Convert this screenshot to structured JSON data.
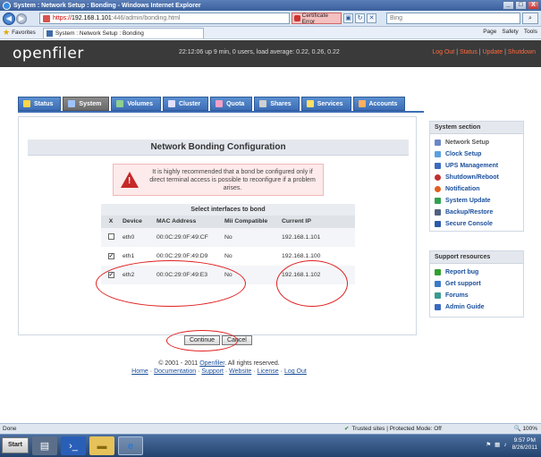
{
  "window": {
    "title": "System : Network Setup : Bonding - Windows Internet Explorer",
    "controls": [
      "_",
      "□",
      "X"
    ]
  },
  "address": {
    "scheme": "https://",
    "host": "192.168.1.101",
    "path": ":446/admin/bonding.html",
    "cert_error": "Certificate Error",
    "search_placeholder": "Bing"
  },
  "favbar": {
    "favorites": "Favorites",
    "tab_title": "System : Network Setup : Bonding",
    "tools": [
      "Page",
      "Safety",
      "Tools"
    ]
  },
  "header": {
    "logo": "openfiler",
    "uptime": "22:12:06 up 9 min, 0 users, load average: 0.22, 0.26, 0.22",
    "links": [
      "Log Out",
      "Status",
      "Update",
      "Shutdown"
    ]
  },
  "tabs": [
    {
      "label": "Status"
    },
    {
      "label": "System"
    },
    {
      "label": "Volumes"
    },
    {
      "label": "Cluster"
    },
    {
      "label": "Quota"
    },
    {
      "label": "Shares"
    },
    {
      "label": "Services"
    },
    {
      "label": "Accounts"
    }
  ],
  "main": {
    "title": "Network Bonding Configuration",
    "warning": "It is highly recommended that a bond be configured only if direct terminal access is possible to reconfigure if a problem arises.",
    "table_caption": "Select interfaces to bond",
    "columns": [
      "X",
      "Device",
      "MAC Address",
      "Mii Compatible",
      "Current IP"
    ],
    "rows": [
      {
        "device": "eth0",
        "mac": "00:0C:29:0F:49:CF",
        "mii": "No",
        "ip": "192.168.1.101"
      },
      {
        "device": "eth1",
        "mac": "00:0C:29:0F:49:D9",
        "mii": "No",
        "ip": "192.168.1.100"
      },
      {
        "device": "eth2",
        "mac": "00:0C:29:0F:49:E3",
        "mii": "No",
        "ip": "192.168.1.102"
      }
    ],
    "continue_label": "Continue",
    "cancel_label": "Cancel"
  },
  "system_section": {
    "title": "System section",
    "items": [
      "Network Setup",
      "Clock Setup",
      "UPS Management",
      "Shutdown/Reboot",
      "Notification",
      "System Update",
      "Backup/Restore",
      "Secure Console"
    ]
  },
  "support": {
    "title": "Support resources",
    "items": [
      "Report bug",
      "Get support",
      "Forums",
      "Admin Guide"
    ]
  },
  "footer": {
    "copyright": "© 2001 - 2011 ",
    "brand_link": "Openfiler",
    "rights": ". All rights reserved.",
    "links": [
      "Home",
      "Documentation",
      "Support",
      "Website",
      "License",
      "Log Out"
    ]
  },
  "statusbar": {
    "status": "Done",
    "zone": "Trusted sites | Protected Mode: Off",
    "zoom": "100%"
  },
  "taskbar": {
    "start": "Start",
    "time": "9:57 PM",
    "date": "8/26/2011"
  }
}
